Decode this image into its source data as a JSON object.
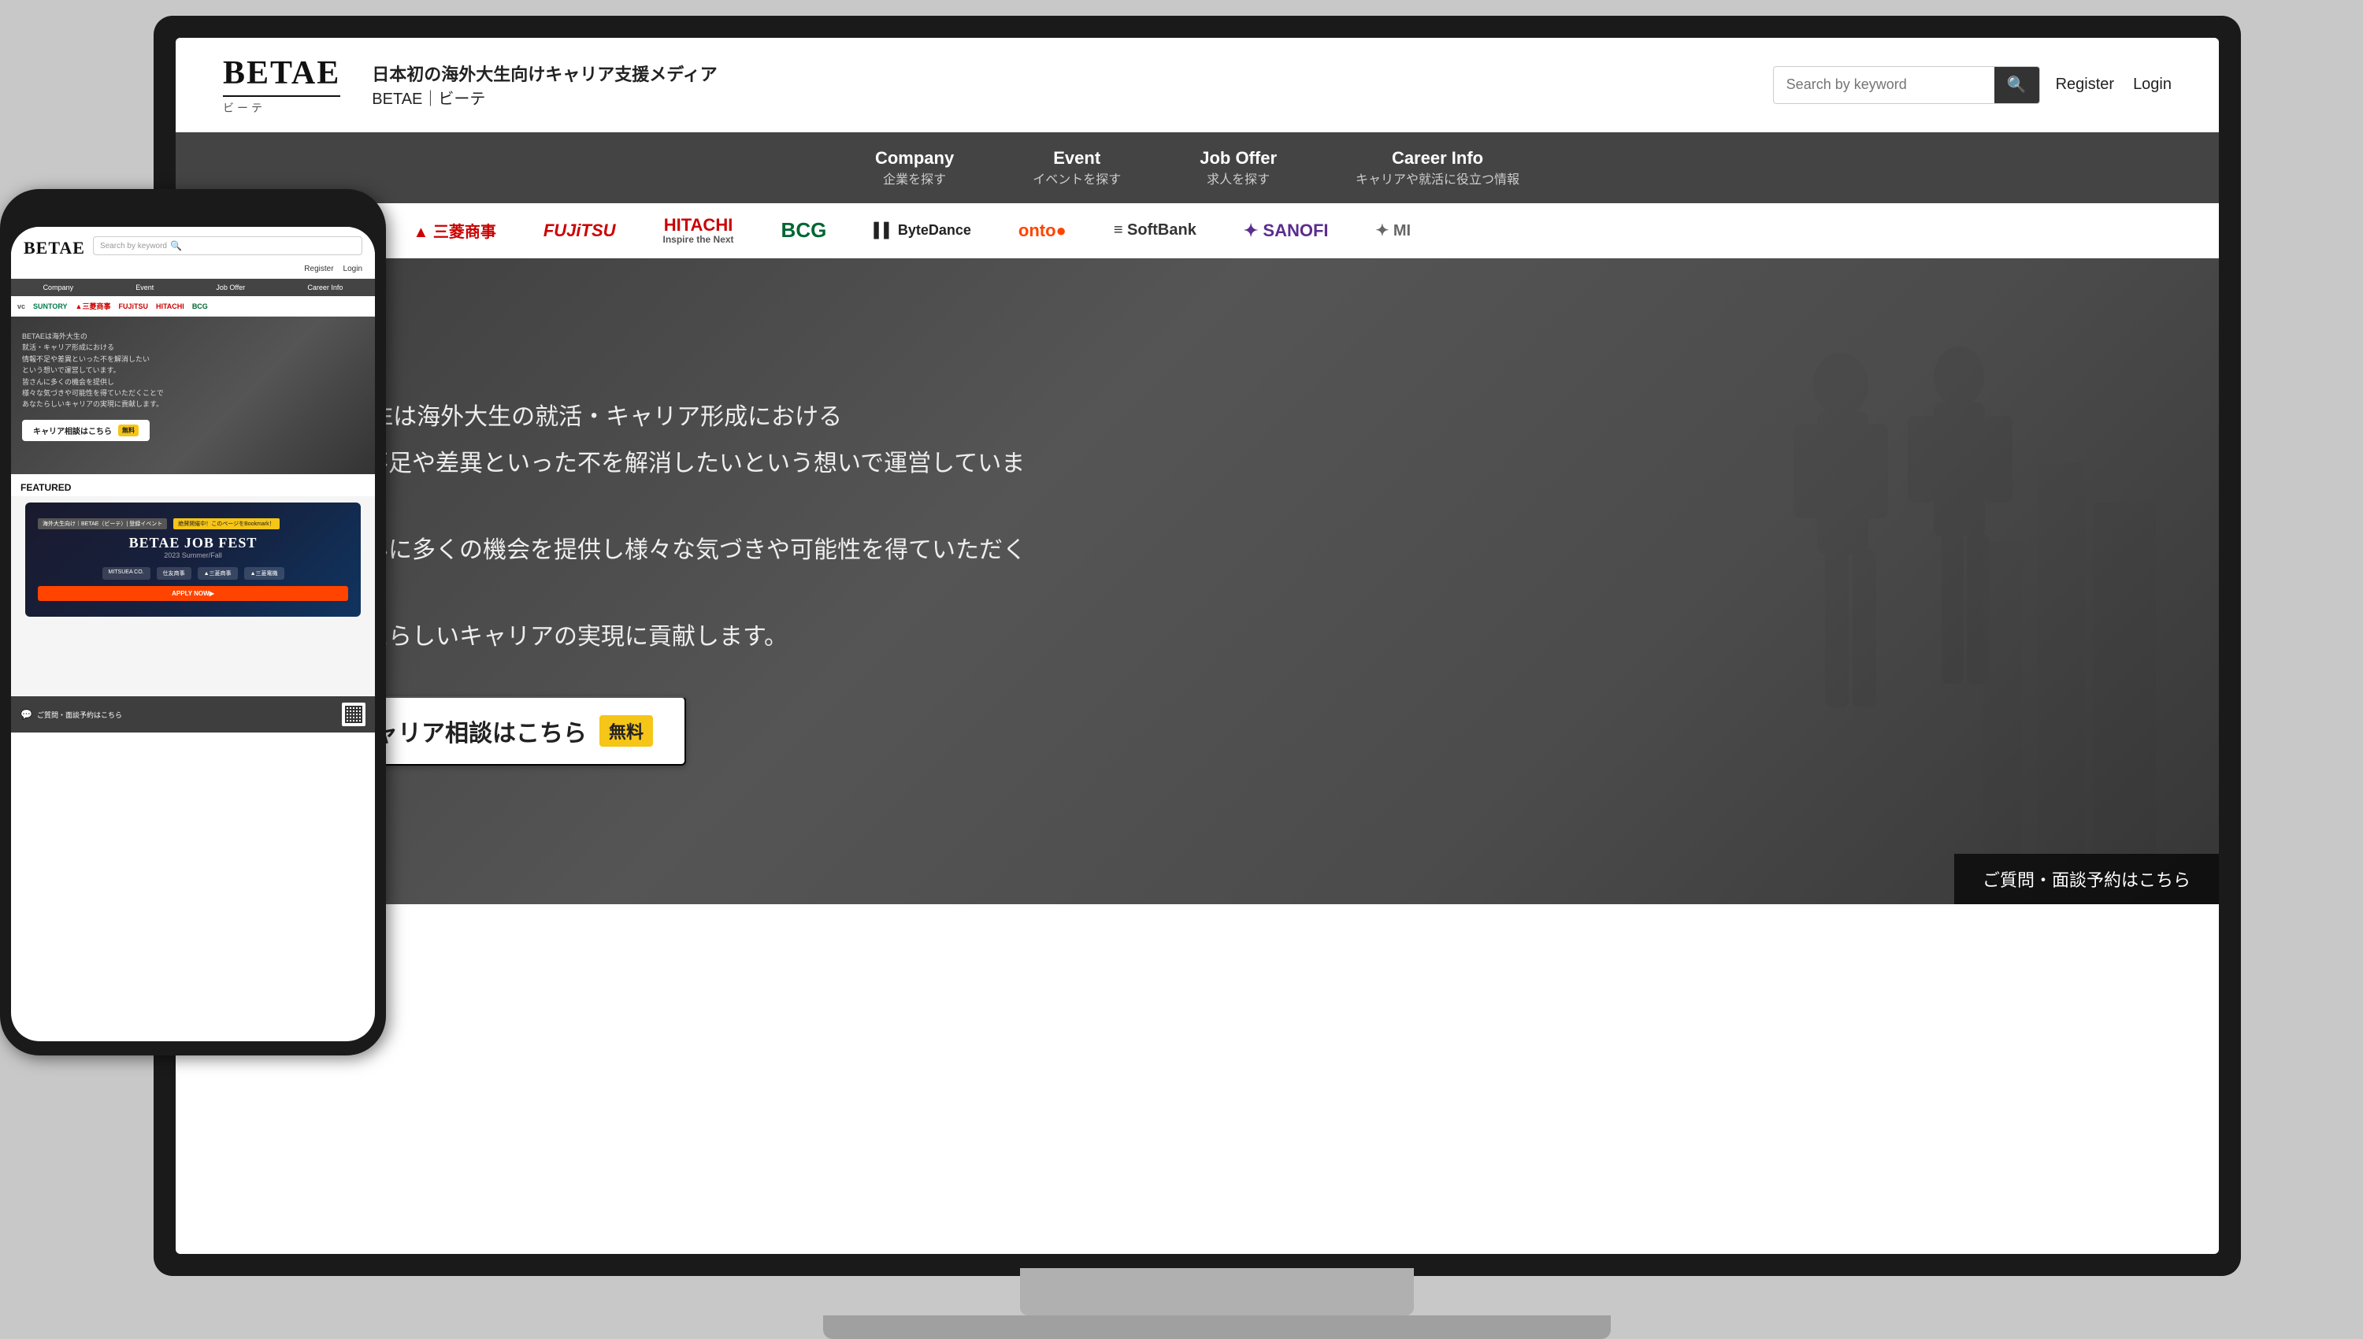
{
  "meta": {
    "bg_color": "#c8c8c8"
  },
  "header": {
    "logo": "BETAE",
    "logo_line_visible": true,
    "logo_sub": "ビーテ",
    "tagline_main": "日本初の海外大生向けキャリア支援メディア",
    "tagline_sub": "BETAE｜ビーテ",
    "search_placeholder": "Search by keyword",
    "search_icon": "🔍",
    "register_label": "Register",
    "login_label": "Login"
  },
  "nav": {
    "items": [
      {
        "label": "Company",
        "sub": "企業を探す"
      },
      {
        "label": "Event",
        "sub": "イベントを探す"
      },
      {
        "label": "Job Offer",
        "sub": "求人を探す"
      },
      {
        "label": "Career Info",
        "sub": "キャリアや就活に役立つ情報"
      }
    ]
  },
  "sponsors": [
    {
      "name": "vc",
      "display": "vc",
      "class": ""
    },
    {
      "name": "suntory",
      "display": "SUNTORY",
      "class": "sponsor-suntory"
    },
    {
      "name": "mitsubishi",
      "display": "▲ 三菱商事",
      "class": "sponsor-mitsubishi"
    },
    {
      "name": "fujitsu",
      "display": "FUJiTSU",
      "class": "sponsor-fujitsu"
    },
    {
      "name": "hitachi",
      "display": "HITACHI Inspire the Next",
      "class": "sponsor-hitachi"
    },
    {
      "name": "bcg",
      "display": "BCG",
      "class": "sponsor-bcg"
    },
    {
      "name": "bytedance",
      "display": "▌▌ ByteDance",
      "class": "sponsor-bytedance"
    },
    {
      "name": "onto",
      "display": "onto●",
      "class": "sponsor-onto"
    },
    {
      "name": "softbank",
      "display": "≡ SoftBank",
      "class": "sponsor-softbank"
    },
    {
      "name": "sanofi",
      "display": "✦ SANOFI",
      "class": "sponsor-sanofi"
    }
  ],
  "hero": {
    "text_lines": [
      "BETAEは海外大生の就活・キャリア形成における",
      "情報不足や差異といった不を解消したいという想いで運営しています。",
      "皆さんに多くの機会を提供し様々な気づきや可能性を得ていただくことで",
      "あなたらしいキャリアの実現に貢献します。"
    ],
    "career_btn_label": "キャリア相談はこちら",
    "free_badge_label": "無料",
    "bottom_bar_label": "ご質問・面談予約はこちら"
  },
  "mobile": {
    "logo": "BETAE",
    "search_placeholder": "Search by keyword",
    "register_label": "Register",
    "login_label": "Login",
    "nav_items": [
      "Company",
      "Event",
      "Job Offer",
      "Career Info"
    ],
    "hero_texts": [
      "BETAEは海外大生の",
      "就活・キャリア形成における",
      "情報不足や差異といった不を解消したい",
      "という想いで運営しています。",
      "皆さんに多くの機会を提供し",
      "様々な気づきや可能性を得ていただくことで",
      "あなたらしいキャリアの実現に貢献します。"
    ],
    "career_btn_label": "キャリア相談はこちら",
    "free_badge_label": "無料",
    "featured_label": "FEATURED",
    "featured_tag1": "海外大生向け｜BETAE（ビーテ）| 登録イベント",
    "featured_tag2": "絶賛開催中！このページをBookmark！",
    "featured_title": "BETAE JOB FEST",
    "featured_year": "2023 Summer/Fall",
    "featured_logos": [
      "MITSUEA CO.",
      "仕友商事",
      "▲三菱商事",
      "▲三菱電機"
    ],
    "bottom_bar_label": "ご質問・面談予約はこちら"
  }
}
